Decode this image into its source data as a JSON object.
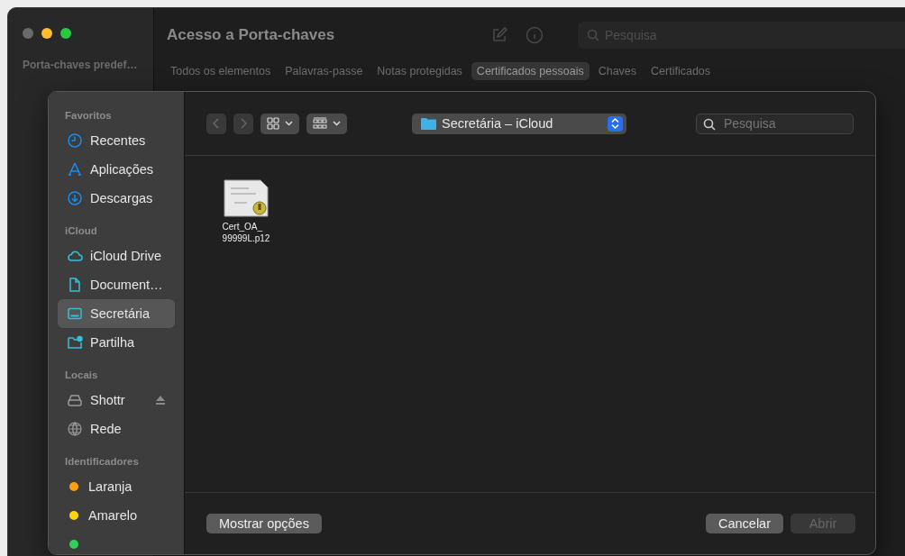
{
  "window": {
    "title": "Acesso a Porta-chaves",
    "search": {
      "placeholder": "Pesquisa"
    },
    "sidebar_heading": "Porta-chaves predef…",
    "tabs": [
      {
        "label": "Todos os elementos",
        "selected": false
      },
      {
        "label": "Palavras-passe",
        "selected": false
      },
      {
        "label": "Notas protegidas",
        "selected": false
      },
      {
        "label": "Certificados pessoais",
        "selected": true
      },
      {
        "label": "Chaves",
        "selected": false
      },
      {
        "label": "Certificados",
        "selected": false
      }
    ]
  },
  "sheet": {
    "sidebar": [
      {
        "heading": "Favoritos",
        "items": [
          {
            "kind": "clock",
            "label": "Recentes",
            "selected": false
          },
          {
            "kind": "apps",
            "label": "Aplicações",
            "selected": false
          },
          {
            "kind": "download",
            "label": "Descargas",
            "selected": false
          }
        ]
      },
      {
        "heading": "iCloud",
        "items": [
          {
            "kind": "cloud",
            "label": "iCloud Drive",
            "selected": false
          },
          {
            "kind": "doc",
            "label": "Document…",
            "selected": false
          },
          {
            "kind": "drive",
            "label": "Secretária",
            "selected": true
          },
          {
            "kind": "shared",
            "label": "Partilha",
            "selected": false
          }
        ]
      },
      {
        "heading": "Locais",
        "items": [
          {
            "kind": "disk",
            "label": "Shottr",
            "selected": false,
            "eject": true
          },
          {
            "kind": "globe",
            "label": "Rede",
            "selected": false
          }
        ]
      },
      {
        "heading": "Identificadores",
        "items": [
          {
            "kind": "tag",
            "label": "Laranja",
            "selected": false,
            "color": "#ff9f0a"
          },
          {
            "kind": "tag",
            "label": "Amarelo",
            "selected": false,
            "color": "#ffd60a"
          },
          {
            "kind": "tag",
            "selected": false,
            "color": "#30d158"
          }
        ]
      }
    ],
    "location": "Secretária – iCloud",
    "search": {
      "placeholder": "Pesquisa"
    },
    "files": [
      {
        "name_lines": [
          "Cert_OA_",
          "99999L.p12"
        ]
      }
    ],
    "buttons": {
      "options": {
        "label": "Mostrar opções",
        "disabled": false
      },
      "cancel": {
        "label": "Cancelar",
        "disabled": false
      },
      "open": {
        "label": "Abrir",
        "disabled": true
      }
    }
  }
}
